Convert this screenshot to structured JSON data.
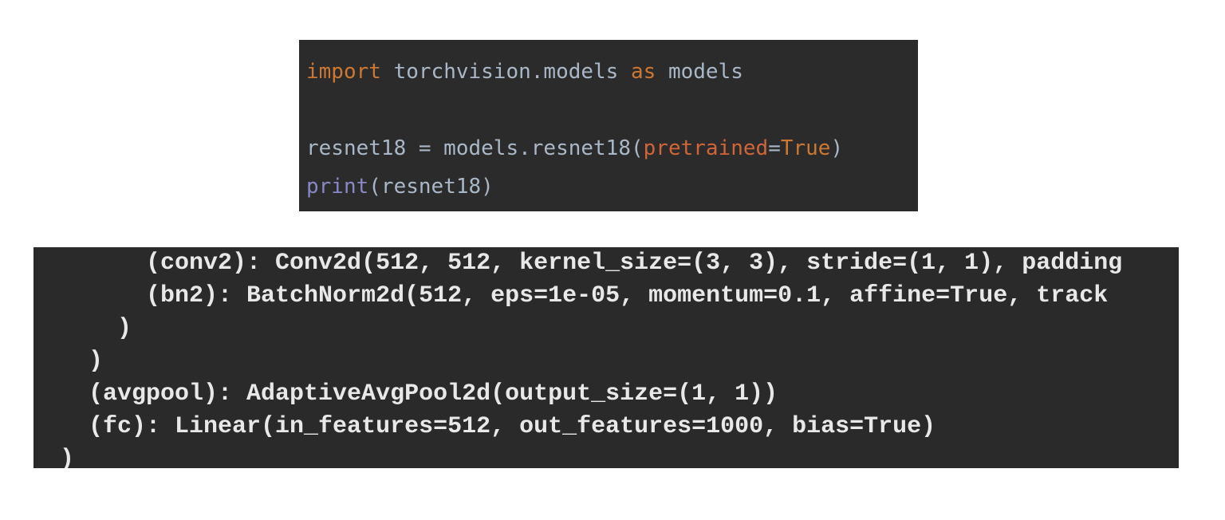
{
  "code_cell": {
    "line1": {
      "kw_import": "import",
      "module": " torchvision.models ",
      "kw_as": "as",
      "alias": " models"
    },
    "line3": {
      "assign": "resnet18 = models.resnet18(",
      "param": "pretrained",
      "eq": "=",
      "value": "True",
      "close": ")"
    },
    "line4": {
      "func": "print",
      "args": "(resnet18)"
    }
  },
  "output": {
    "lines": [
      "      (conv2): Conv2d(512, 512, kernel_size=(3, 3), stride=(1, 1), padding",
      "      (bn2): BatchNorm2d(512, eps=1e-05, momentum=0.1, affine=True, track",
      "    )",
      "  )",
      "  (avgpool): AdaptiveAvgPool2d(output_size=(1, 1))",
      "  (fc): Linear(in_features=512, out_features=1000, bias=True)",
      ")"
    ]
  },
  "colors": {
    "code_background": "#2b2b2b",
    "output_background": "#2a2a2a",
    "keyword": "#cc7832",
    "parameter": "#d0653a",
    "builtin": "#8888c6",
    "code_text": "#a9b7c6",
    "output_text": "#e8e8e8"
  }
}
